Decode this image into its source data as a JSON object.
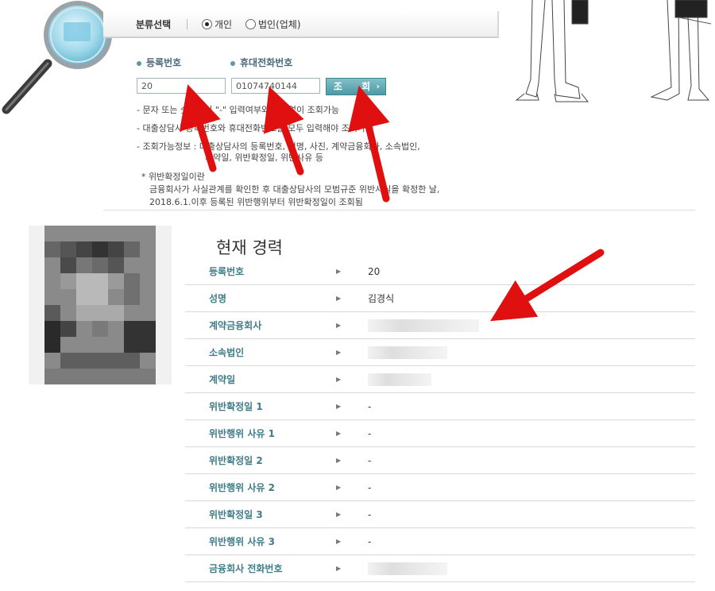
{
  "category": {
    "label": "분류선택",
    "options": [
      {
        "label": "개인",
        "checked": true
      },
      {
        "label": "법인(업체)",
        "checked": false
      }
    ]
  },
  "form": {
    "reg_no_label": "등록번호",
    "phone_label": "휴대전화번호",
    "reg_no_value": "20",
    "phone_value": "01074740144",
    "search_label": "조 회",
    "search_chevron": "›"
  },
  "notes": [
    "- 문자 또는 숫자사이 \"-\" 입력여부와 관계없이 조회가능",
    "- 대출상담사 등록번호와 휴대전화번호를 모두 입력해야 조회가능",
    "- 조회가능정보 : 대출상담사의 등록번호, 성명, 사진, 계약금융회사, 소속법인,",
    "계약일, 위반확정일, 위반사유 등"
  ],
  "violation_note": {
    "title": "* 위반확정일이란",
    "line1": "금융회사가 사실관계를 확인한 후 대출상담사의 모범규준 위반사실을 확정한 날,",
    "line2": "2018.6.1.이후 등록된 위반행위부터 위반확정일이 조회됨"
  },
  "career": {
    "title": "현재 경력",
    "rows": [
      {
        "key": "등록번호",
        "value": "20"
      },
      {
        "key": "성명",
        "value": "김경식"
      },
      {
        "key": "계약금융회사",
        "value": ""
      },
      {
        "key": "소속법인",
        "value": ""
      },
      {
        "key": "계약일",
        "value": ""
      },
      {
        "key": "위반확정일 1",
        "value": "-"
      },
      {
        "key": "위반행위 사유 1",
        "value": "-"
      },
      {
        "key": "위반확정일 2",
        "value": "-"
      },
      {
        "key": "위반행위 사유 2",
        "value": "-"
      },
      {
        "key": "위반확정일 3",
        "value": "-"
      },
      {
        "key": "위반행위 사유 3",
        "value": "-"
      },
      {
        "key": "금융회사 전화번호",
        "value": ""
      }
    ],
    "row_arrow": "▶"
  },
  "colors": {
    "accent": "#3f7d88",
    "button": "#5aa6b0",
    "annotation_arrow": "#e01010"
  },
  "icons": [
    "magnifier-illustration",
    "people-illustration",
    "radio-icon",
    "chevron-right-icon"
  ]
}
